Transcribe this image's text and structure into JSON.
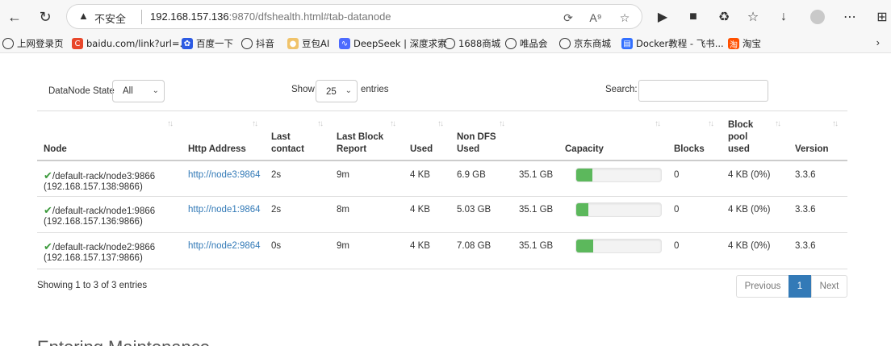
{
  "browser": {
    "insecure_label": "不安全",
    "url_host": "192.168.157.136",
    "url_rest": ":9870/dfshealth.html#tab-datanode"
  },
  "bookmarks": [
    {
      "label": "上网登录页",
      "icon": "globe-icon"
    },
    {
      "label": "baidu.com/link?url=...",
      "icon": "c-icon",
      "color": "#e8472b"
    },
    {
      "label": "百度一下",
      "icon": "paw-icon",
      "color": "#2d5be3"
    },
    {
      "label": "抖音",
      "icon": "globe-icon"
    },
    {
      "label": "豆包AI",
      "icon": "doubao-icon"
    },
    {
      "label": "DeepSeek | 深度求索",
      "icon": "deepseek-icon",
      "color": "#4d6bfe"
    },
    {
      "label": "1688商城",
      "icon": "globe-icon"
    },
    {
      "label": "唯品会",
      "icon": "globe-icon"
    },
    {
      "label": "京东商城",
      "icon": "globe-icon"
    },
    {
      "label": "Docker教程 - 飞书...",
      "icon": "feishu-doc-icon",
      "color": "#3370ff"
    },
    {
      "label": "淘宝",
      "icon": "taobao-icon",
      "color": "#ff5000"
    }
  ],
  "controls": {
    "state_label": "DataNode State",
    "state_value": "All",
    "show_label": "Show",
    "page_length": "25",
    "entries_label": "entries",
    "search_label": "Search:",
    "search_value": ""
  },
  "table": {
    "headers": {
      "node": "Node",
      "http": "Http Address",
      "last_contact_1": "Last",
      "last_contact_2": "contact",
      "last_block_1": "Last Block",
      "last_block_2": "Report",
      "used": "Used",
      "nondfs_1": "Non DFS",
      "nondfs_2": "Used",
      "capacity": "Capacity",
      "blocks": "Blocks",
      "pool_1": "Block",
      "pool_2": "pool",
      "pool_3": "used",
      "version": "Version"
    },
    "rows": [
      {
        "node": "/default-rack/node3:9866",
        "ip": "(192.168.157.138:9866)",
        "http": "http://node3:9864",
        "last_contact": "2s",
        "last_block": "9m",
        "used": "4 KB",
        "nondfs": "6.9 GB",
        "capacity": "35.1 GB",
        "capacity_used_fraction": 0.19,
        "blocks": "0",
        "pool": "4 KB (0%)",
        "version": "3.3.6"
      },
      {
        "node": "/default-rack/node1:9866",
        "ip": "(192.168.157.136:9866)",
        "http": "http://node1:9864",
        "last_contact": "2s",
        "last_block": "8m",
        "used": "4 KB",
        "nondfs": "5.03 GB",
        "capacity": "35.1 GB",
        "capacity_used_fraction": 0.14,
        "blocks": "0",
        "pool": "4 KB (0%)",
        "version": "3.3.6"
      },
      {
        "node": "/default-rack/node2:9866",
        "ip": "(192.168.157.137:9866)",
        "http": "http://node2:9864",
        "last_contact": "0s",
        "last_block": "9m",
        "used": "4 KB",
        "nondfs": "7.08 GB",
        "capacity": "35.1 GB",
        "capacity_used_fraction": 0.2,
        "blocks": "0",
        "pool": "4 KB (0%)",
        "version": "3.3.6"
      }
    ]
  },
  "footer": {
    "showing": "Showing 1 to 3 of 3 entries",
    "previous": "Previous",
    "page": "1",
    "next": "Next"
  },
  "next_section_title": "Entering Maintenance",
  "colors": {
    "progress": "#5cb85c",
    "link": "#337ab7",
    "active_page": "#337ab7"
  }
}
